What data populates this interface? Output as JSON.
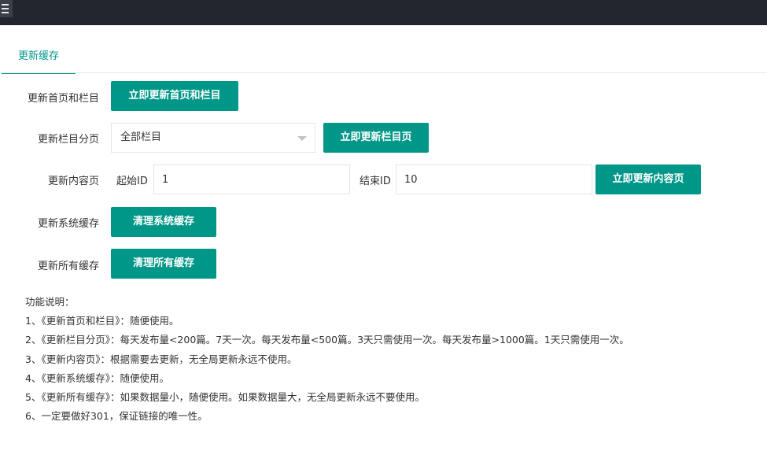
{
  "header": {
    "menu_icon": "hamburger-icon"
  },
  "tabs": [
    {
      "label": "更新缓存",
      "active": true
    }
  ],
  "rows": {
    "home": {
      "label": "更新首页和栏目",
      "button": "立即更新首页和栏目"
    },
    "category": {
      "label": "更新栏目分页",
      "select_value": "全部栏目",
      "button": "立即更新栏目页"
    },
    "content": {
      "label": "更新内容页",
      "start_label": "起始ID",
      "start_value": "1",
      "end_label": "结束ID",
      "end_value": "10",
      "button": "立即更新内容页"
    },
    "system": {
      "label": "更新系统缓存",
      "button": "清理系统缓存"
    },
    "all": {
      "label": "更新所有缓存",
      "button": "清理所有缓存"
    }
  },
  "notes": {
    "title": "功能说明：",
    "items": [
      "1、《更新首页和栏目》：随便使用。",
      "2、《更新栏目分页》：每天发布量<200篇。7天一次。每天发布量<500篇。3天只需使用一次。每天发布量>1000篇。1天只需使用一次。",
      "3、《更新内容页》：根据需要去更新，无全局更新永远不使用。",
      "4、《更新系统缓存》：随便使用。",
      "5、《更新所有缓存》：如果数据量小，随便使用。如果数据量大，无全局更新永远不要使用。",
      "6、一定要做好301，保证链接的唯一性。"
    ]
  },
  "colors": {
    "primary": "#009688",
    "topbar": "#23262e"
  }
}
